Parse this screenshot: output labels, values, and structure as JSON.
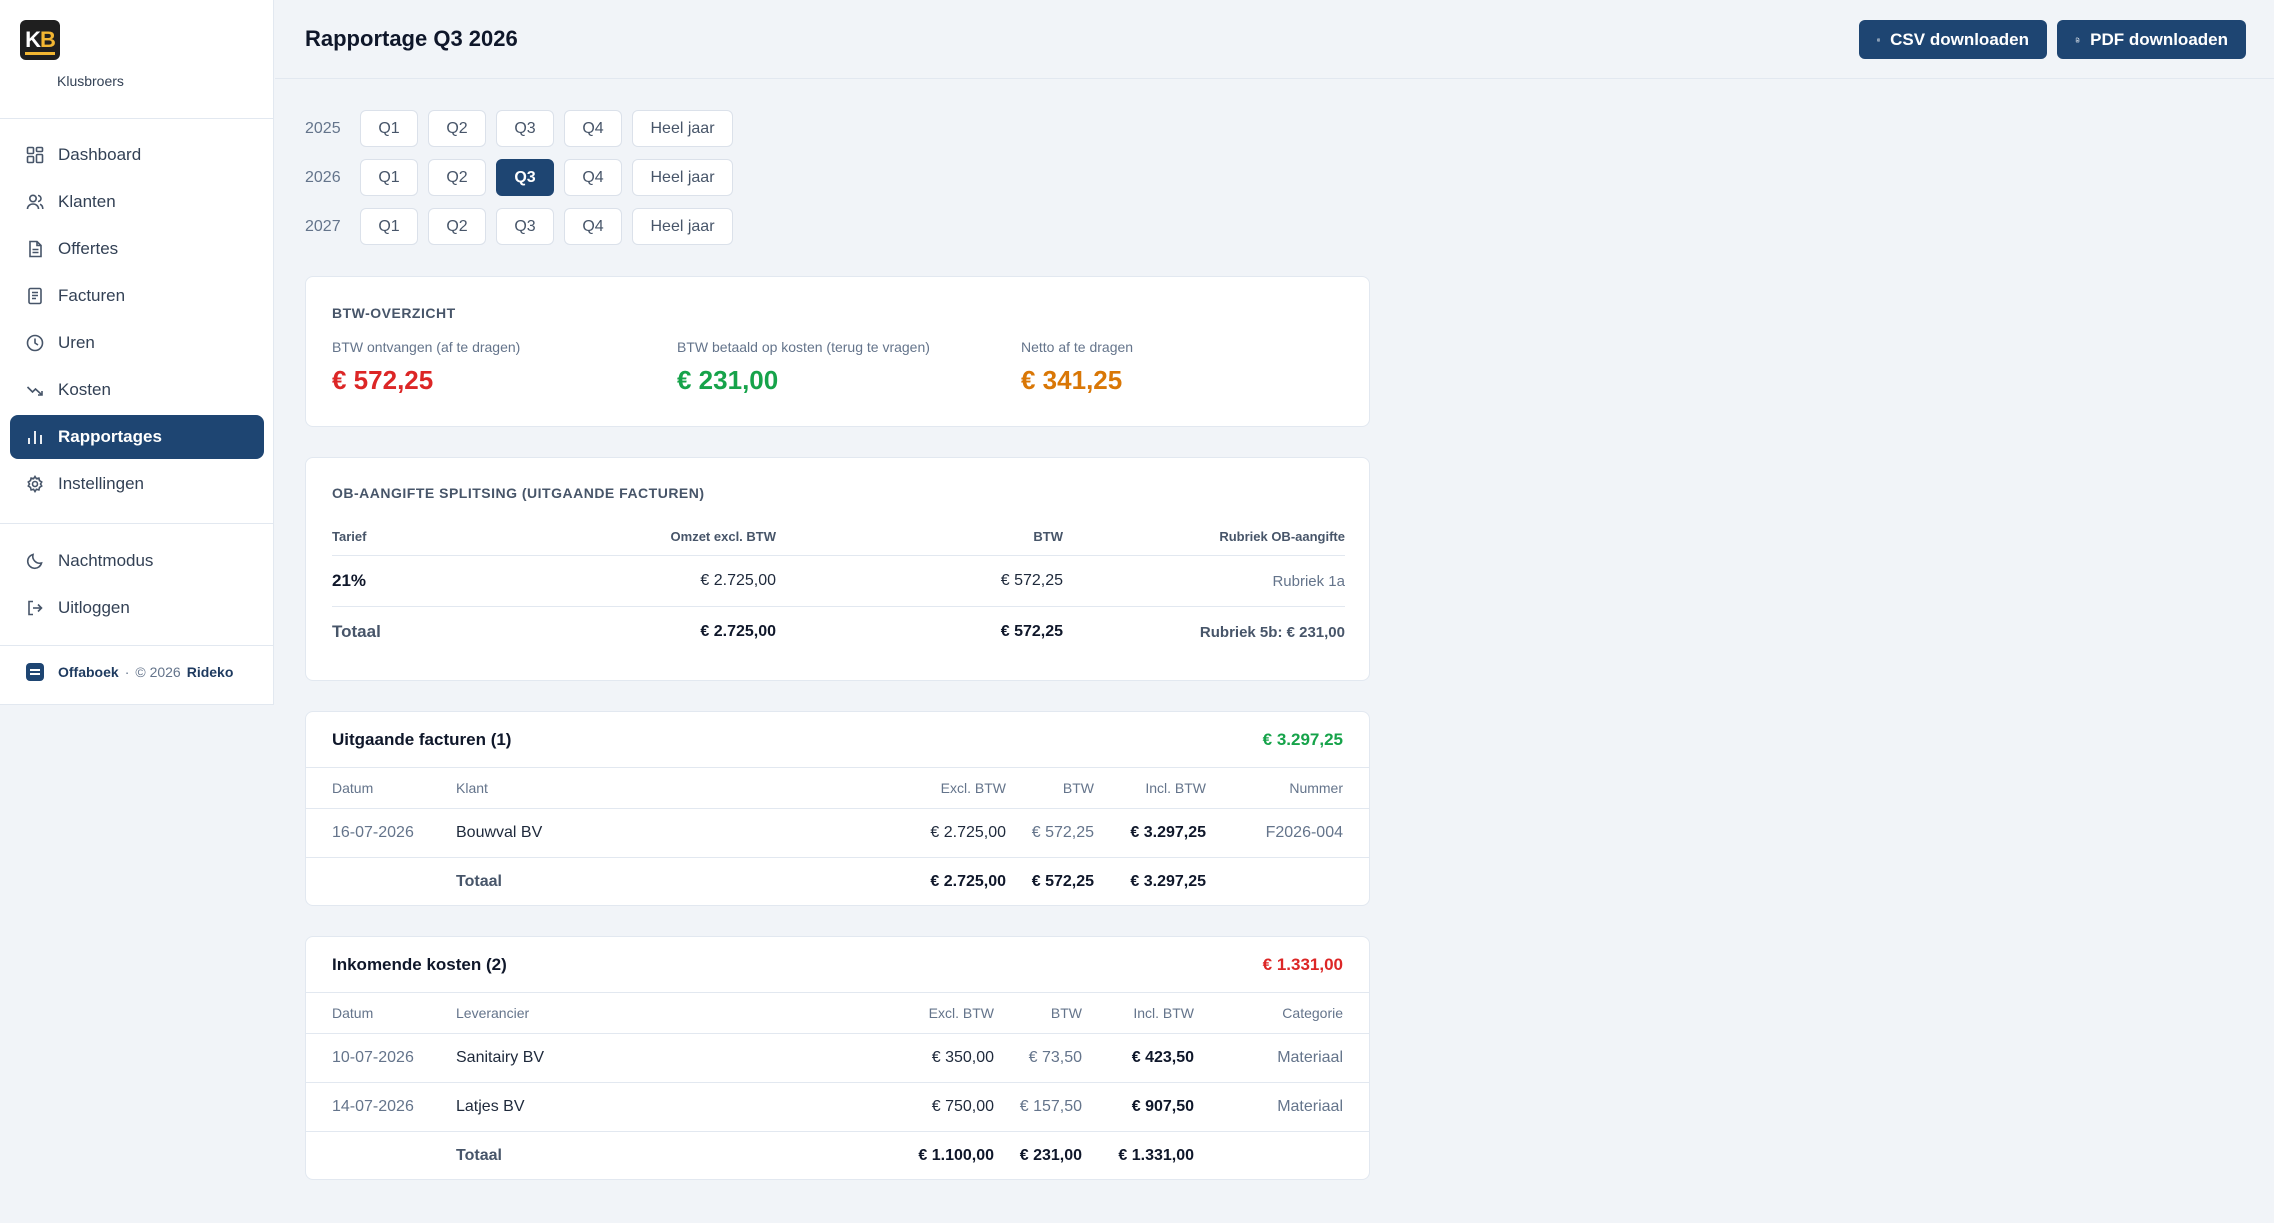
{
  "brand": {
    "logo_k": "K",
    "logo_b": "B",
    "name": "Klusbroers"
  },
  "nav": [
    {
      "label": "Dashboard",
      "icon": "grid-icon"
    },
    {
      "label": "Klanten",
      "icon": "users-icon"
    },
    {
      "label": "Offertes",
      "icon": "file-text-icon"
    },
    {
      "label": "Facturen",
      "icon": "receipt-icon"
    },
    {
      "label": "Uren",
      "icon": "clock-icon"
    },
    {
      "label": "Kosten",
      "icon": "trending-down-icon"
    },
    {
      "label": "Rapportages",
      "icon": "bar-chart-icon",
      "active": true
    },
    {
      "label": "Instellingen",
      "icon": "gear-icon"
    }
  ],
  "nav2": [
    {
      "label": "Nachtmodus",
      "icon": "moon-icon"
    },
    {
      "label": "Uitloggen",
      "icon": "logout-icon"
    }
  ],
  "footer": {
    "app": "Offaboek",
    "sep": "·",
    "copy": "© 2026",
    "company": "Rideko"
  },
  "header": {
    "title": "Rapportage Q3 2026",
    "csv_label": "CSV downloaden",
    "pdf_label": "PDF downloaden"
  },
  "periods": [
    {
      "year": "2025",
      "buttons": [
        "Q1",
        "Q2",
        "Q3",
        "Q4",
        "Heel jaar"
      ]
    },
    {
      "year": "2026",
      "buttons": [
        "Q1",
        "Q2",
        "Q3",
        "Q4",
        "Heel jaar"
      ],
      "selected": "Q3"
    },
    {
      "year": "2027",
      "buttons": [
        "Q1",
        "Q2",
        "Q3",
        "Q4",
        "Heel jaar"
      ]
    }
  ],
  "btw": {
    "title": "BTW-OVERZICHT",
    "received_label": "BTW ontvangen (af te dragen)",
    "received_value": "€ 572,25",
    "paid_label": "BTW betaald op kosten (terug te vragen)",
    "paid_value": "€ 231,00",
    "net_label": "Netto af te dragen",
    "net_value": "€ 341,25"
  },
  "ob": {
    "title": "OB-AANGIFTE SPLITSING (UITGAANDE FACTUREN)",
    "headers": [
      "Tarief",
      "Omzet excl. BTW",
      "BTW",
      "Rubriek OB-aangifte"
    ],
    "row": [
      "21%",
      "€ 2.725,00",
      "€ 572,25",
      "Rubriek 1a"
    ],
    "total": [
      "Totaal",
      "€ 2.725,00",
      "€ 572,25",
      "Rubriek 5b: € 231,00"
    ]
  },
  "outgoing": {
    "title": "Uitgaande facturen (1)",
    "total": "€ 3.297,25",
    "headers": [
      "Datum",
      "Klant",
      "Excl. BTW",
      "BTW",
      "Incl. BTW",
      "Nummer"
    ],
    "rows": [
      [
        "16-07-2026",
        "Bouwval BV",
        "€ 2.725,00",
        "€ 572,25",
        "€ 3.297,25",
        "F2026-004"
      ]
    ],
    "totals": [
      "Totaal",
      "€ 2.725,00",
      "€ 572,25",
      "€ 3.297,25"
    ]
  },
  "incoming": {
    "title": "Inkomende kosten (2)",
    "total": "€ 1.331,00",
    "headers": [
      "Datum",
      "Leverancier",
      "Excl. BTW",
      "BTW",
      "Incl. BTW",
      "Categorie"
    ],
    "rows": [
      [
        "10-07-2026",
        "Sanitairy BV",
        "€ 350,00",
        "€ 73,50",
        "€ 423,50",
        "Materiaal"
      ],
      [
        "14-07-2026",
        "Latjes BV",
        "€ 750,00",
        "€ 157,50",
        "€ 907,50",
        "Materiaal"
      ]
    ],
    "totals": [
      "Totaal",
      "€ 1.100,00",
      "€ 231,00",
      "€ 1.331,00"
    ]
  },
  "colors": {
    "primary": "#1e4572",
    "red": "#dc2626",
    "green": "#16a34a",
    "orange": "#d97706",
    "total_green": "#16a34a",
    "total_red": "#dc2626"
  }
}
